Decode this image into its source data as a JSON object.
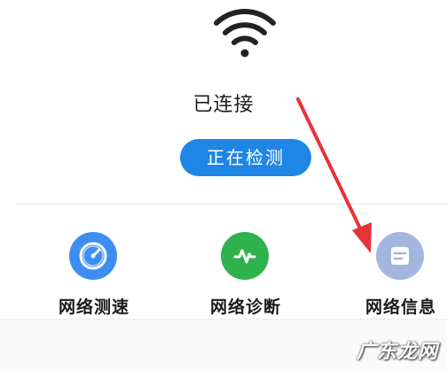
{
  "wifi": {
    "icon": "wifi-icon",
    "status": "已连接"
  },
  "detect_button": {
    "label": "正在检测",
    "color": "#1f86e6"
  },
  "actions": [
    {
      "label": "网络测速",
      "icon": "speedometer-icon",
      "color": "#3d8ef0"
    },
    {
      "label": "网络诊断",
      "icon": "pulse-icon",
      "color": "#2fb24c"
    },
    {
      "label": "网络信息",
      "icon": "info-document-icon",
      "color": "#a3b6e0"
    }
  ],
  "annotation": {
    "arrow_color": "#e8323a",
    "points_to": "网络信息"
  },
  "watermark": {
    "text": "广东龙网"
  }
}
